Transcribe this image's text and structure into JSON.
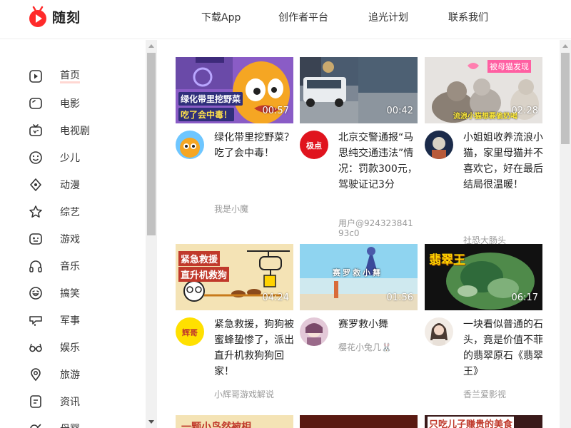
{
  "header": {
    "logo_text": "随刻",
    "nav": [
      "下载App",
      "创作者平台",
      "追光计划",
      "联系我们"
    ]
  },
  "sidebar": {
    "items": [
      {
        "label": "首页",
        "icon": "play-icon"
      },
      {
        "label": "电影",
        "icon": "movie-icon"
      },
      {
        "label": "电视剧",
        "icon": "tv-icon"
      },
      {
        "label": "少儿",
        "icon": "smile-icon"
      },
      {
        "label": "动漫",
        "icon": "anime-icon"
      },
      {
        "label": "综艺",
        "icon": "star-icon"
      },
      {
        "label": "游戏",
        "icon": "gamepad-icon"
      },
      {
        "label": "音乐",
        "icon": "headphones-icon"
      },
      {
        "label": "搞笑",
        "icon": "laugh-icon"
      },
      {
        "label": "军事",
        "icon": "military-icon"
      },
      {
        "label": "娱乐",
        "icon": "glasses-icon"
      },
      {
        "label": "旅游",
        "icon": "location-icon"
      },
      {
        "label": "资讯",
        "icon": "news-icon"
      },
      {
        "label": "母婴",
        "icon": "baby-icon"
      }
    ]
  },
  "videos": [
    {
      "title": "绿化带里挖野菜？吃了会中毒！",
      "author": "我是小魔",
      "duration": "00:57",
      "thumb_caption_a": "绿化带里挖野菜",
      "thumb_caption_b": "吃了会中毒！"
    },
    {
      "title": "北京交警通报“马思纯交通违法”情况：罚款300元，驾驶证记3分",
      "author": "用户@92432384193c0",
      "duration": "00:42"
    },
    {
      "title": "小姐姐收养流浪小猫，家里母猫并不喜欢它，好在最后结局很温暖！",
      "author": "社恐大肠头",
      "duration": "02:28",
      "thumb_caption_a": "被母猫发现",
      "thumb_caption_b": "流浪小猫想要偷奶喝"
    },
    {
      "title": "紧急救援，狗狗被蜜蜂蛰惨了，派出直升机救狗狗回家！",
      "author": "小辉哥游戏解说",
      "duration": "04:24",
      "thumb_caption_a": "紧急救援",
      "thumb_caption_b": "直升机救狗"
    },
    {
      "title": "赛罗救小舞",
      "author": "樱花小兔几🐰",
      "duration": "01:56",
      "thumb_caption_a": "赛罗救小舞"
    },
    {
      "title": "一块看似普通的石头，竟是价值不菲的翡翠原石《翡翠王》",
      "author": "香兰爱影视",
      "duration": "06:17",
      "thumb_caption_a": "翡翠王"
    }
  ],
  "partial_row": {
    "thumb_caption_left": "一颗小鸟然被相",
    "thumb_caption_right": "只吃儿子赚贵的美食"
  },
  "colors": {
    "brand_red": "#ff3b30",
    "text": "#222222",
    "muted": "#999999"
  }
}
